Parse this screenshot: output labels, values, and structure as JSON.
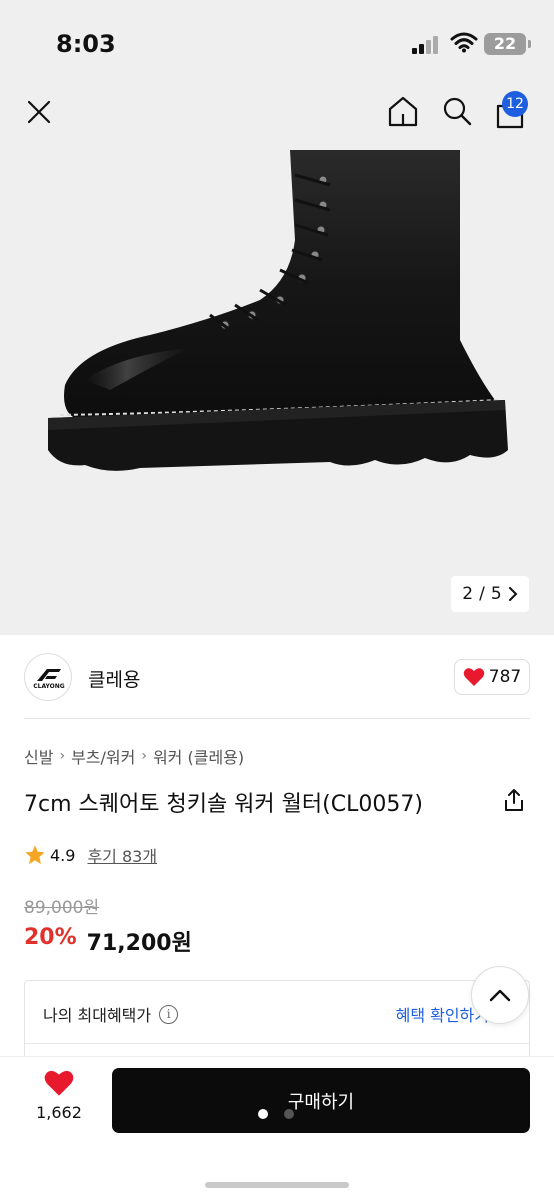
{
  "status_bar": {
    "time": "8:03",
    "battery": "22"
  },
  "header": {
    "cart_count": "12"
  },
  "gallery": {
    "current": "2",
    "separator": "/",
    "total": "5"
  },
  "brand": {
    "name": "클레용",
    "logo_text": "CLAYONG",
    "likes": "787"
  },
  "breadcrumb": [
    "신발",
    "부츠/워커",
    "워커 (클레용)"
  ],
  "product": {
    "title": "7cm 스퀘어토 청키솔 워커 월터(CL0057)",
    "rating": "4.9",
    "review_text": "후기 83개",
    "original_price": "89,000원",
    "discount": "20%",
    "price": "71,200원"
  },
  "benefit": {
    "label": "나의 최대혜택가",
    "link": "혜택 확인하기"
  },
  "bottom_bar": {
    "wish_count": "1,662",
    "buy_label": "구매하기"
  },
  "colors": {
    "accent_blue": "#1e5fe0",
    "discount_red": "#e0312b",
    "heart_red": "#e8192c",
    "star": "#f5a623",
    "buy_bg": "#0b0b0b"
  },
  "icons": [
    "close-icon",
    "home-icon",
    "search-icon",
    "cart-icon",
    "chevron-right-icon",
    "heart-icon",
    "share-icon",
    "star-icon",
    "info-icon",
    "chevron-up-icon"
  ]
}
